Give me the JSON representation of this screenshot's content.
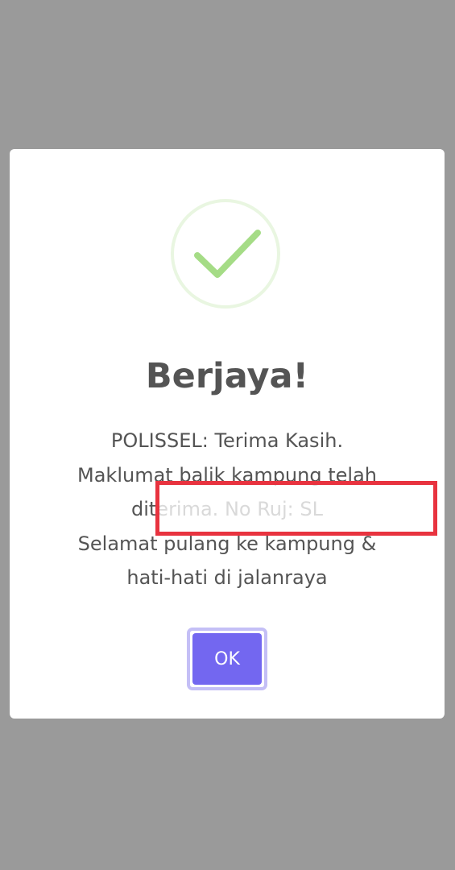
{
  "dialog": {
    "icon": "checkmark-success-icon",
    "title": "Berjaya!",
    "message_lines": [
      "POLISSEL: Terima Kasih.",
      "Maklumat balik kampung telah",
      "diterima. No Ruj: SL",
      "Selamat pulang ke kampung &",
      "hati-hati di jalanraya"
    ],
    "ok_label": "OK"
  },
  "colors": {
    "overlay": "#9a9a9a",
    "title_text": "#545454",
    "success_green": "#a5dc86",
    "success_ring": "#e9f6e1",
    "button": "#7367f0",
    "highlight_box": "#e8333f"
  }
}
